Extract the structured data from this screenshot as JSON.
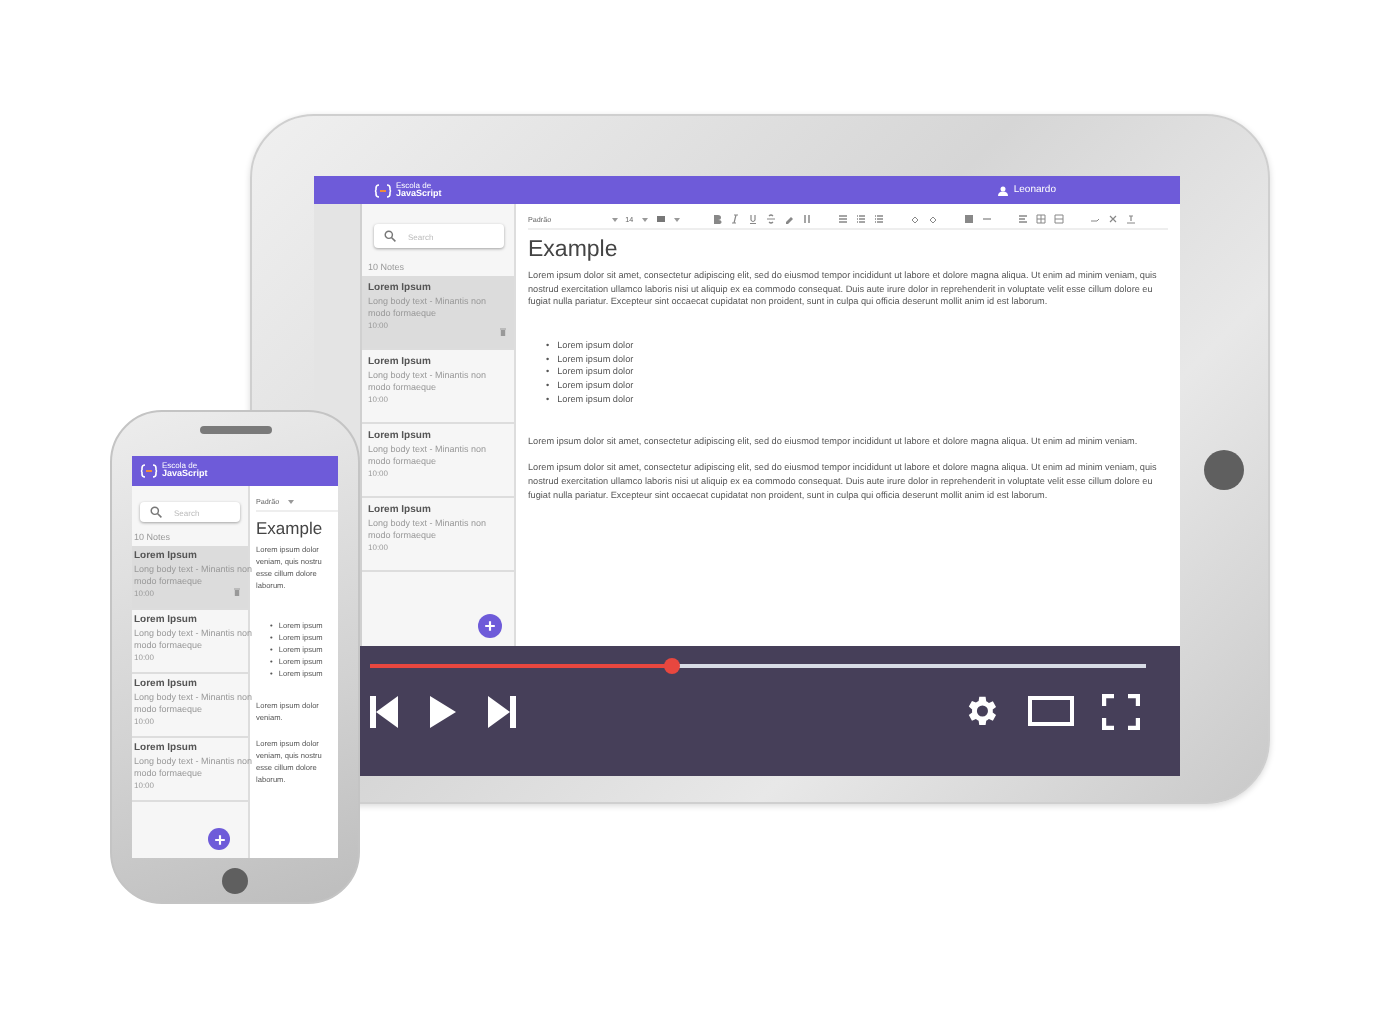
{
  "tablet": {
    "app": {
      "header": {
        "logo_top": "Escola de",
        "logo_bottom": "JavaScript",
        "user": "Leonardo"
      },
      "search": {
        "placeholder": "Search"
      },
      "notes_count": "10 Notes",
      "notes": [
        {
          "title": "Lorem Ipsum",
          "body": "Long body text - Minantis non modo formaeque",
          "time": "10:00",
          "selected": true
        },
        {
          "title": "Lorem Ipsum",
          "body": "Long body text - Minantis non modo formaeque",
          "time": "10:00",
          "selected": false
        },
        {
          "title": "Lorem Ipsum",
          "body": "Long body text - Minantis non modo formaeque",
          "time": "10:00",
          "selected": false
        },
        {
          "title": "Lorem Ipsum",
          "body": "Long body text - Minantis non modo formaeque",
          "time": "10:00",
          "selected": false
        }
      ],
      "toolbar": {
        "style": "Padrão",
        "size": "14"
      },
      "document": {
        "title": "Example",
        "blocks": [
          {
            "kind": "paragraph",
            "text": "Lorem ipsum dolor sit amet, consectetur adipiscing elit, sed do eiusmod tempor incididunt ut labore et dolore magna aliqua. Ut enim ad minim veniam, quis nostrud exercitation ullamco laboris nisi ut aliquip ex ea commodo consequat. Duis aute irure dolor in reprehenderit in voluptate velit esse cillum dolore eu fugiat nulla pariatur. Excepteur sint occaecat cupidatat non proident, sunt in culpa qui officia deserunt mollit anim id est laborum."
          },
          {
            "kind": "list",
            "marker": "•",
            "items": [
              "Lorem ipsum dolor",
              "Lorem ipsum dolor",
              "Lorem ipsum dolor",
              "Lorem ipsum dolor",
              "Lorem ipsum dolor"
            ]
          },
          {
            "kind": "paragraph",
            "text": "Lorem ipsum dolor sit amet, consectetur adipiscing elit, sed do eiusmod tempor incididunt ut labore et dolore magna aliqua. Ut enim ad minim veniam."
          },
          {
            "kind": "paragraph",
            "text": "Lorem ipsum dolor sit amet, consectetur adipiscing elit, sed do eiusmod tempor incididunt ut labore et dolore magna aliqua. Ut enim ad minim veniam, quis nostrud exercitation ullamco laboris nisi ut aliquip ex ea commodo consequat. Duis aute irure dolor in reprehenderit in voluptate velit esse cillum dolore eu fugiat nulla pariatur. Excepteur sint occaecat cupidatat non proident, sunt in culpa qui officia deserunt mollit anim id est laborum."
          }
        ]
      }
    },
    "video_player": {
      "level": 0.39
    }
  },
  "phone": {
    "app": {
      "header": {
        "logo_top": "Escola de",
        "logo_bottom": "JavaScript"
      },
      "search": {
        "placeholder": "Search"
      },
      "notes_count": "10 Notes",
      "notes": [
        {
          "title": "Lorem Ipsum",
          "body": "Long body text - Minantis non modo formaeque",
          "time": "10:00",
          "selected": true
        },
        {
          "title": "Lorem Ipsum",
          "body": "Long body text - Minantis non modo formaeque",
          "time": "10:00",
          "selected": false
        },
        {
          "title": "Lorem Ipsum",
          "body": "Long body text - Minantis non modo formaeque",
          "time": "10:00",
          "selected": false
        },
        {
          "title": "Lorem Ipsum",
          "body": "Long body text - Minantis non modo formaeque",
          "time": "10:00",
          "selected": false
        }
      ],
      "toolbar": {
        "style": "Padrão"
      },
      "document": {
        "title": "Example",
        "blocks": [
          {
            "kind": "clipped",
            "lines": [
              "Lorem ipsum dolor",
              "veniam, quis nostru",
              "esse cillum dolore",
              "laborum."
            ]
          },
          {
            "kind": "list",
            "marker": "•",
            "items": [
              "Lorem ipsum",
              "Lorem ipsum",
              "Lorem ipsum",
              "Lorem ipsum",
              "Lorem ipsum"
            ]
          },
          {
            "kind": "clipped",
            "lines": [
              "Lorem ipsum dolor",
              "veniam."
            ]
          },
          {
            "kind": "clipped",
            "lines": [
              "Lorem ipsum dolor",
              "veniam, quis nostru",
              "esse cillum dolore",
              "laborum."
            ]
          }
        ]
      }
    }
  }
}
